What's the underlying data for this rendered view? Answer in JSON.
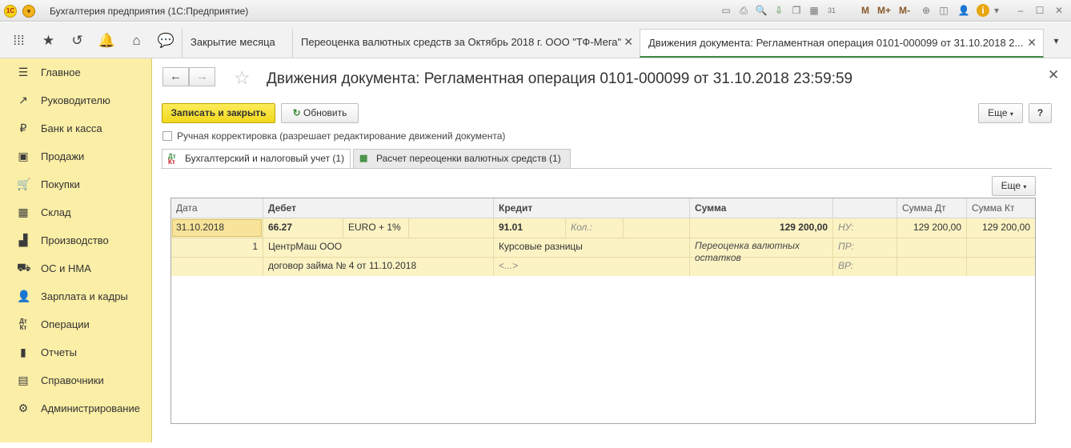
{
  "titlebar": {
    "logo_text": "1С",
    "app_title": "Бухгалтерия предприятия  (1С:Предприятие)",
    "icons": [
      "save-icon",
      "print-icon",
      "print-preview-icon",
      "attach-icon",
      "copy-icon",
      "calculator-icon",
      "calendar-icon"
    ],
    "calendar_day": "31",
    "memory": [
      "M",
      "M+",
      "M-"
    ],
    "window_buttons": [
      "minimize-icon",
      "maximize-icon",
      "close-icon"
    ]
  },
  "tabs": [
    {
      "label": "Закрытие месяца"
    },
    {
      "label": "Переоценка валютных средств за Октябрь 2018 г. ООО \"ТФ-Мега\""
    },
    {
      "label": "Движения документа: Регламентная операция 0101-000099 от 31.10.2018 2..."
    }
  ],
  "sidebar": {
    "items": [
      {
        "label": "Главное",
        "icon": "menu-icon"
      },
      {
        "label": "Руководителю",
        "icon": "chart-line-icon"
      },
      {
        "label": "Банк и касса",
        "icon": "ruble-icon"
      },
      {
        "label": "Продажи",
        "icon": "shopping-bag-icon"
      },
      {
        "label": "Покупки",
        "icon": "cart-icon"
      },
      {
        "label": "Склад",
        "icon": "warehouse-icon"
      },
      {
        "label": "Производство",
        "icon": "factory-icon"
      },
      {
        "label": "ОС и НМА",
        "icon": "truck-icon"
      },
      {
        "label": "Зарплата и кадры",
        "icon": "person-icon"
      },
      {
        "label": "Операции",
        "icon": "dt-kt-icon"
      },
      {
        "label": "Отчеты",
        "icon": "bar-chart-icon"
      },
      {
        "label": "Справочники",
        "icon": "book-icon"
      },
      {
        "label": "Администрирование",
        "icon": "gear-icon"
      }
    ]
  },
  "document": {
    "title": "Движения документа: Регламентная операция 0101-000099 от 31.10.2018 23:59:59",
    "save_close": "Записать и закрыть",
    "refresh": "Обновить",
    "more": "Еще",
    "help": "?",
    "manual_checkbox": "Ручная корректировка (разрешает редактирование движений документа)",
    "inner_tabs": [
      {
        "label": "Бухгалтерский и налоговый учет (1)"
      },
      {
        "label": "Расчет переоценки валютных средств (1)"
      }
    ],
    "table_more": "Еще",
    "dtkt_top": "Дт",
    "dtkt_bottom": "Кт"
  },
  "table": {
    "headers": {
      "date": "Дата",
      "debit": "Дебет",
      "credit": "Кредит",
      "sum": "Сумма",
      "sum_dt": "Сумма Дт",
      "sum_kt": "Сумма Кт"
    },
    "row": {
      "date": "31.10.2018",
      "num": "1",
      "debit_account": "66.27",
      "debit_currency": "EURO + 1%",
      "debit_sub1": "ЦентрМаш ООО",
      "debit_sub2": "договор займа № 4 от 11.10.2018",
      "credit_account": "91.01",
      "credit_qty_label": "Кол.:",
      "credit_sub1": "Курсовые разницы",
      "credit_sub2": "<...>",
      "sum": "129 200,00",
      "content": "Переоценка валютных остатков",
      "nu_label": "НУ:",
      "pr_label": "ПР:",
      "vr_label": "ВР:",
      "sum_dt": "129 200,00",
      "sum_kt": "129 200,00"
    }
  }
}
